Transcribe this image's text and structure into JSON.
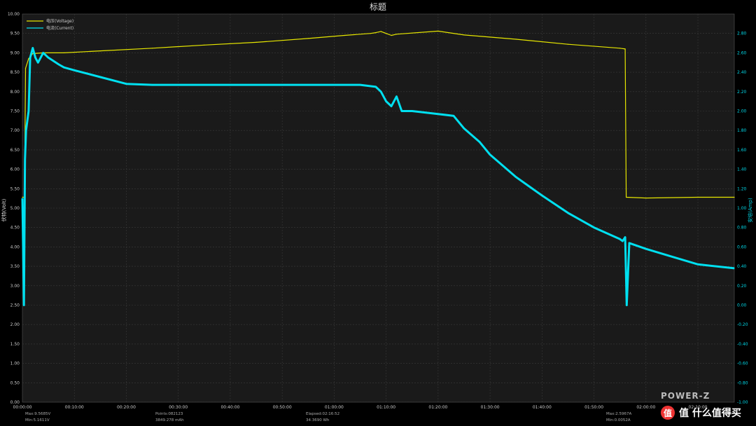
{
  "chart_data": {
    "type": "line",
    "title": "标题",
    "ylabel_left": "伏特(Volt)",
    "ylabel_right": "安培(Amp)",
    "legend_position": "top-left",
    "grid": true,
    "x_ticks": [
      "00:00:00",
      "00:10:00",
      "00:20:00",
      "00:30:00",
      "00:40:00",
      "00:50:00",
      "01:00:00",
      "01:10:00",
      "01:20:00",
      "01:30:00",
      "01:40:00",
      "01:50:00",
      "02:00:00",
      "02:10:00"
    ],
    "y_left_ticks": [
      "10.00",
      "9.50",
      "9.00",
      "8.50",
      "8.00",
      "7.50",
      "7.00",
      "6.50",
      "6.00",
      "5.50",
      "5.00",
      "4.50",
      "4.00",
      "3.50",
      "3.00",
      "2.50",
      "2.00",
      "1.50",
      "1.00",
      "0.50",
      "0.00"
    ],
    "y_right_ticks": [
      "2.80",
      "2.60",
      "2.40",
      "2.20",
      "2.00",
      "1.80",
      "1.60",
      "1.40",
      "1.20",
      "1.00",
      "0.80",
      "0.60",
      "0.40",
      "0.20",
      "0.00",
      "-0.20",
      "-0.40",
      "-0.60",
      "-0.80",
      "-1.00"
    ],
    "ylim_left": [
      0,
      10
    ],
    "ylim_right": [
      -1.0,
      3.0
    ],
    "xlim_minutes": [
      0,
      137
    ],
    "series": [
      {
        "name": "电压(Voltage)",
        "axis": "left",
        "color": "#e6e600",
        "x_minutes": [
          0,
          0.4,
          0.6,
          1.2,
          2,
          4,
          8,
          15,
          25,
          35,
          45,
          55,
          62,
          67,
          68,
          69,
          70,
          71,
          72,
          80,
          85,
          95,
          105,
          115,
          116,
          116.2,
          120,
          130,
          137
        ],
        "values": [
          5.28,
          5.28,
          8.6,
          8.85,
          8.98,
          9.0,
          9.0,
          9.05,
          9.12,
          9.2,
          9.27,
          9.37,
          9.45,
          9.5,
          9.52,
          9.55,
          9.5,
          9.45,
          9.48,
          9.56,
          9.46,
          9.35,
          9.22,
          9.12,
          9.1,
          5.28,
          5.26,
          5.28,
          5.28
        ]
      },
      {
        "name": "电流(Current)",
        "axis": "right",
        "color": "#00e0f0",
        "x_minutes": [
          0,
          0.3,
          0.5,
          0.7,
          1.2,
          1.5,
          2.0,
          2.5,
          3,
          4,
          5,
          7,
          8,
          10,
          15,
          20,
          25,
          30,
          40,
          50,
          60,
          65,
          68,
          69,
          70,
          71,
          72,
          73,
          75,
          80,
          83,
          85,
          88,
          90,
          95,
          100,
          105,
          110,
          115,
          115.5,
          116,
          116.3,
          116.8,
          120,
          125,
          130,
          137
        ],
        "values": [
          1.1,
          0.0,
          1.5,
          1.8,
          2.0,
          2.55,
          2.65,
          2.55,
          2.5,
          2.6,
          2.55,
          2.48,
          2.45,
          2.42,
          2.35,
          2.28,
          2.27,
          2.27,
          2.27,
          2.27,
          2.27,
          2.27,
          2.25,
          2.2,
          2.1,
          2.05,
          2.15,
          2.0,
          2.0,
          1.97,
          1.95,
          1.82,
          1.68,
          1.55,
          1.32,
          1.13,
          0.95,
          0.8,
          0.68,
          0.66,
          0.7,
          0.0,
          0.64,
          0.58,
          0.5,
          0.42,
          0.38
        ]
      }
    ]
  },
  "footer": {
    "max_voltage": "Max:9.5685V",
    "min_voltage": "Min:5.1611V",
    "points": "Points:082123",
    "energy_mah": "3849.278 mAh",
    "elapsed": "Elapsed:02:16:52",
    "energy_wh": "34.3690 Wh",
    "max_current": "Max:2.5967A",
    "min_current": "Min:0.0052A"
  },
  "brand": "POWER-Z",
  "watermark": "值 什么值得买"
}
